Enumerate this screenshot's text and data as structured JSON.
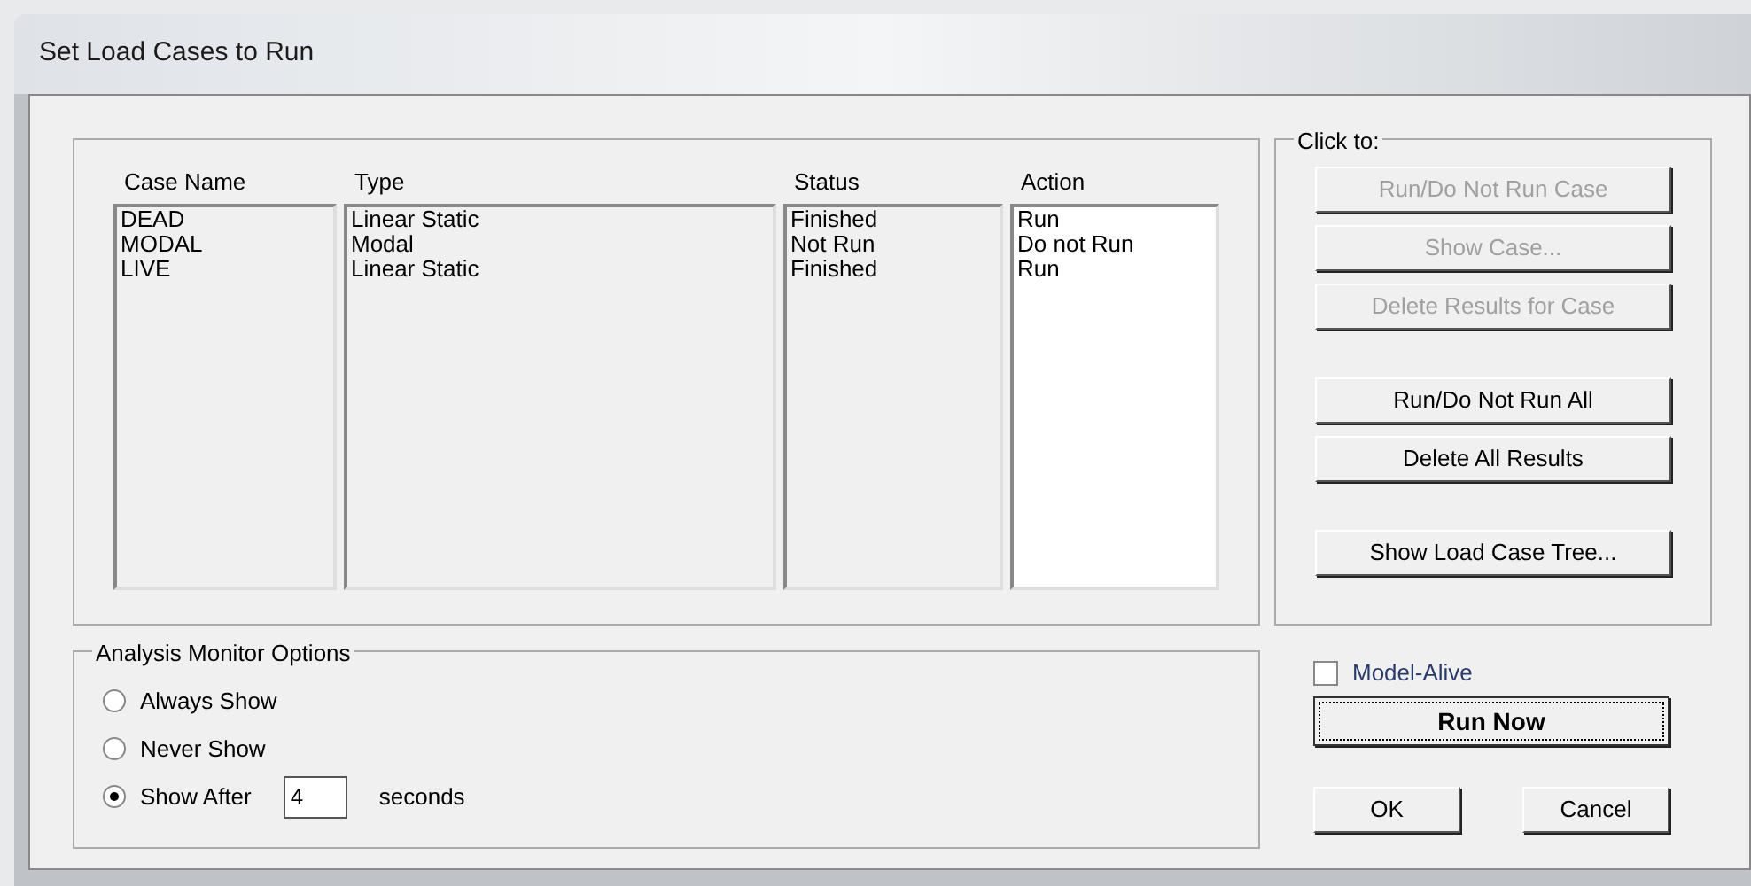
{
  "window": {
    "title": "Set Load Cases to Run"
  },
  "cases": {
    "columns": [
      {
        "label": "Case Name",
        "white": false
      },
      {
        "label": "Type",
        "white": false
      },
      {
        "label": "Status",
        "white": false
      },
      {
        "label": "Action",
        "white": true
      }
    ],
    "rows": [
      [
        "DEAD",
        "Linear Static",
        "Finished",
        "Run"
      ],
      [
        "MODAL",
        "Modal",
        "Not Run",
        "Do not Run"
      ],
      [
        "LIVE",
        "Linear Static",
        "Finished",
        "Run"
      ]
    ]
  },
  "monitor": {
    "title": "Analysis Monitor Options",
    "options": [
      {
        "label": "Always Show",
        "selected": false
      },
      {
        "label": "Never Show",
        "selected": false
      },
      {
        "label": "Show After",
        "selected": true
      }
    ],
    "seconds_value": "4",
    "seconds_unit": "seconds"
  },
  "click_to": {
    "title": "Click to:",
    "buttons": [
      {
        "label": "Run/Do Not Run Case",
        "disabled": true
      },
      {
        "label": "Show Case...",
        "disabled": true
      },
      {
        "label": "Delete Results for Case",
        "disabled": true
      },
      {
        "label": "Run/Do Not Run All",
        "disabled": false
      },
      {
        "label": "Delete All Results",
        "disabled": false
      },
      {
        "label": "Show Load Case Tree...",
        "disabled": false
      }
    ]
  },
  "model_alive": {
    "label": "Model-Alive",
    "checked": false
  },
  "run_now": {
    "label": "Run Now",
    "focused": true
  },
  "footer_buttons": [
    "OK",
    "Cancel"
  ]
}
